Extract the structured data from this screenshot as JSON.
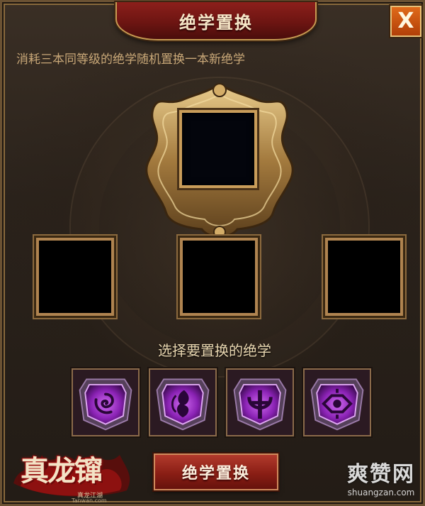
{
  "window": {
    "title": "绝学置换",
    "close_label": "X"
  },
  "description": "消耗三本同等级的绝学随机置换一本新绝学",
  "slots": {
    "result_slot": "empty",
    "input_slots": [
      "empty",
      "empty",
      "empty"
    ]
  },
  "select_label": "选择要置换的绝学",
  "books": [
    {
      "icon": "spiral-rune-icon"
    },
    {
      "icon": "flame-rune-icon"
    },
    {
      "icon": "trident-rune-icon"
    },
    {
      "icon": "eye-rune-icon"
    }
  ],
  "action_button": "绝学置换",
  "logo": {
    "main": "真龙镩",
    "sub": "真龙江湖",
    "url": "Tanwan.com"
  },
  "watermark": {
    "main": "爽赞网",
    "sub": "shuangzan.com"
  },
  "colors": {
    "accent_gold": "#c99d5a",
    "title_red": "#8c1f1b",
    "book_purple": "#a23ad0",
    "close_orange": "#e06a1a"
  }
}
